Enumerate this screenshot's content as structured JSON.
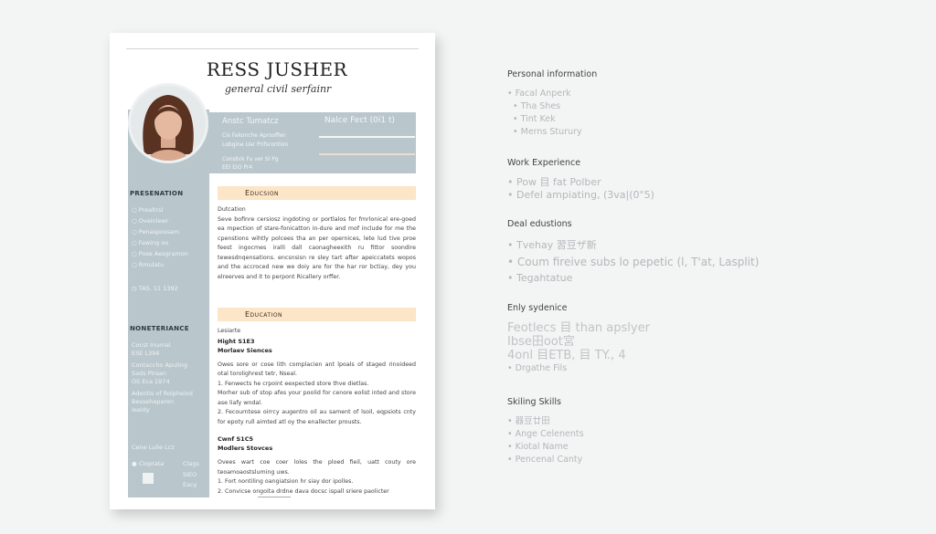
{
  "resume": {
    "name": "RESS JUSHER",
    "subtitle": "general civil serfainr",
    "header_band": {
      "left_title": "Anstc Tumatcz",
      "right_title": "Nalce Fect (0i1 t)",
      "line1": "Cis Fakonche Aprsoffen",
      "line2": "Lobgine Uar Prifsrontion",
      "line3": "Consbrk Fu ver Sl Pg",
      "line4": "EEI EIO Pr4"
    },
    "sidebar": {
      "section1_title": "PRESENATION",
      "section1_items": [
        "Prealtrsl",
        "Oveinlewr",
        "Penaspossam",
        "Fawing oo",
        "Pose Aesgramon",
        "Rmulatu"
      ],
      "phone": "TAS. 11 1392",
      "section2_title": "NONETERIANCE",
      "section2_items": [
        "Cocst Inurnal",
        "ESE L394",
        "Contaccho Apuling",
        "Sads Piraan",
        "OS Eca 1974",
        "Adentis of Roipheiod",
        "Bessehaparen",
        "Iealdy"
      ],
      "footer_label": "Cene Lulie Lcz",
      "footer_items": [
        "Cloprata",
        "Clags",
        "SIEO",
        "Eacy"
      ]
    },
    "main": {
      "section1": {
        "title": "Educsion",
        "sub": "Dutcation",
        "text": "Seve bofinre cersiosz ingdoting or portlalos for fmrlonical ere-goed ea mpection of stare-fonicatton in-dure and mof include for me the cpenstions wihtly polcees tha an per opernices, lete lud tive proe feest ingocmes iralli dall caonagheexith ru fittor soondire tewesdnqensations. encsnsisn re sley tart after apeiccatets wopos and the accroced new we doiy are for the har ror bctiay, dey you elreerves and it to perpont Ricallery orffer."
      },
      "section2": {
        "title": "Education",
        "sub0": "Lesiarte",
        "entry1": {
          "title": "Hight S1E3",
          "org": "Morlaev Siences",
          "text": "Owes sore or cose lith complacien ant lpoals of staged rinoideed otal torolighrest tetr, Nseal.",
          "items": [
            "1. Fenwects he crpoint eexpected store thve dietlas.",
            "Morher sub of stop afes your poolid for cenore eolist inted and store ase liafy wndal.",
            "2. Fecourntese oirrcy augentro oil au sament of lsoil, eqpsiots cnty for epoty rull aimted atl oy the enallecter prousts."
          ]
        },
        "entry2": {
          "title": "Cwnf S1C5",
          "org": "Modlers Stovces",
          "text": "Ovees wart coe coer loles the ploed fieil, uatt couty ore teoamoaostsluming uws.",
          "items": [
            "1. Fort nontiling oangiatsion hr siay dor ipolles.",
            "2. Convicse ongoita drdne dava docsc ispall sriere paolicter"
          ]
        }
      }
    }
  },
  "panel": {
    "sections": [
      {
        "title": "Personal information",
        "items": [
          "Facal Anperk",
          "Tha Shes",
          "Tint Kek",
          "Merns Sturury"
        ]
      },
      {
        "title": "Work Experience",
        "items": [
          "Pow 目 fat Polber",
          "Defel ampiating, (3va|(0\"5)"
        ]
      },
      {
        "title": "Deal edustions",
        "items": [
          "Tvehay 習豆ザ新",
          "Coum fireive subs lo pepetic (l, T'at, Lasplit)",
          "Tegahtatue"
        ]
      },
      {
        "title": "Enly sydenice",
        "big": [
          "Feotlecs 目 than apslyer",
          "Ibse田oot宮",
          "4onl 目ETB, 目 TY., 4"
        ],
        "items": [
          "Drgathe Fils"
        ]
      },
      {
        "title": "Skiling Skills",
        "items": [
          "器豆廿田",
          "Ange Celenents",
          "Kiotal Name",
          "Pencenal Canty"
        ]
      }
    ]
  },
  "colors": {
    "sidebar": "#b9c7cc",
    "section_bar": "#fde5c8",
    "background": "#f3f4f4"
  }
}
